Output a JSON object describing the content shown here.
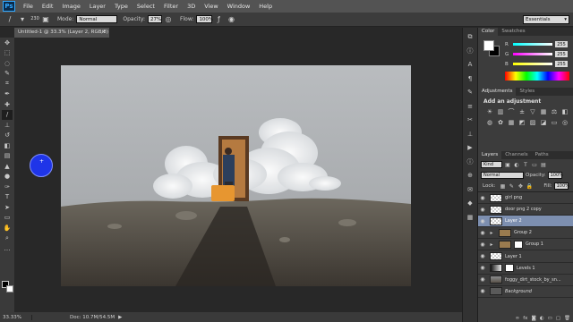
{
  "app": {
    "logo": "Ps"
  },
  "menu": [
    "File",
    "Edit",
    "Image",
    "Layer",
    "Type",
    "Select",
    "Filter",
    "3D",
    "View",
    "Window",
    "Help"
  ],
  "options": {
    "brush_size": "230",
    "mode_label": "Mode:",
    "mode_value": "Normal",
    "opacity_label": "Opacity:",
    "opacity_value": "27%",
    "flow_label": "Flow:",
    "flow_value": "100%",
    "workspace": "Essentials"
  },
  "document": {
    "tab_title": "Untitled-1 @ 33.3% (Layer 2, RGB/8) *",
    "close": "×"
  },
  "status": {
    "zoom": "33.33%",
    "doc": "Doc: 10.7M/54.5M",
    "arrow": "▶"
  },
  "colors": {
    "accent": "#1f35e8",
    "selection": "#7d8fb0",
    "panel_bg": "#3c3c3c"
  },
  "color_panel": {
    "tabs": [
      "Color",
      "Swatches"
    ],
    "rows": [
      {
        "label": "R",
        "value": "255"
      },
      {
        "label": "G",
        "value": "255"
      },
      {
        "label": "B",
        "value": "255"
      }
    ]
  },
  "adjustments": {
    "tabs": [
      "Adjustments",
      "Styles"
    ],
    "title": "Add an adjustment",
    "icons": [
      "brightness-icon",
      "levels-icon",
      "curves-icon",
      "exposure-icon",
      "vibrance-icon",
      "hue-icon",
      "color-balance-icon",
      "bw-icon",
      "photo-filter-icon",
      "channel-mixer-icon",
      "color-lookup-icon",
      "invert-icon",
      "posterize-icon",
      "threshold-icon",
      "gradient-map-icon",
      "selective-color-icon"
    ]
  },
  "layers": {
    "tabs": [
      "Layers",
      "Channels",
      "Paths"
    ],
    "kind": "Kind",
    "blend": "Normal",
    "opacity_label": "Opacity:",
    "opacity_value": "100%",
    "lock_label": "Lock:",
    "fill_label": "Fill:",
    "fill_value": "100%",
    "items": [
      {
        "name": "girl png",
        "thumb": "",
        "selected": false,
        "italic": false
      },
      {
        "name": "door png 2 copy",
        "thumb": "",
        "selected": false,
        "italic": false
      },
      {
        "name": "Layer 2",
        "thumb": "",
        "selected": true,
        "italic": false
      },
      {
        "name": "Group 2",
        "thumb": "group",
        "selected": false,
        "italic": false
      },
      {
        "name": "Group 1",
        "thumb": "group",
        "selected": false,
        "italic": false
      },
      {
        "name": "Layer 1",
        "thumb": "",
        "selected": false,
        "italic": false
      },
      {
        "name": "Levels 1",
        "thumb": "adj",
        "selected": false,
        "italic": false
      },
      {
        "name": "foggy_dirt_stock_by_sn...",
        "thumb": "photo",
        "selected": false,
        "italic": false
      },
      {
        "name": "Background",
        "thumb": "dark",
        "selected": false,
        "italic": true
      }
    ],
    "footer_icons": [
      "link-icon",
      "fx-icon",
      "mask-icon",
      "adjustment-icon",
      "folder-icon",
      "new-layer-icon",
      "trash-icon"
    ]
  }
}
